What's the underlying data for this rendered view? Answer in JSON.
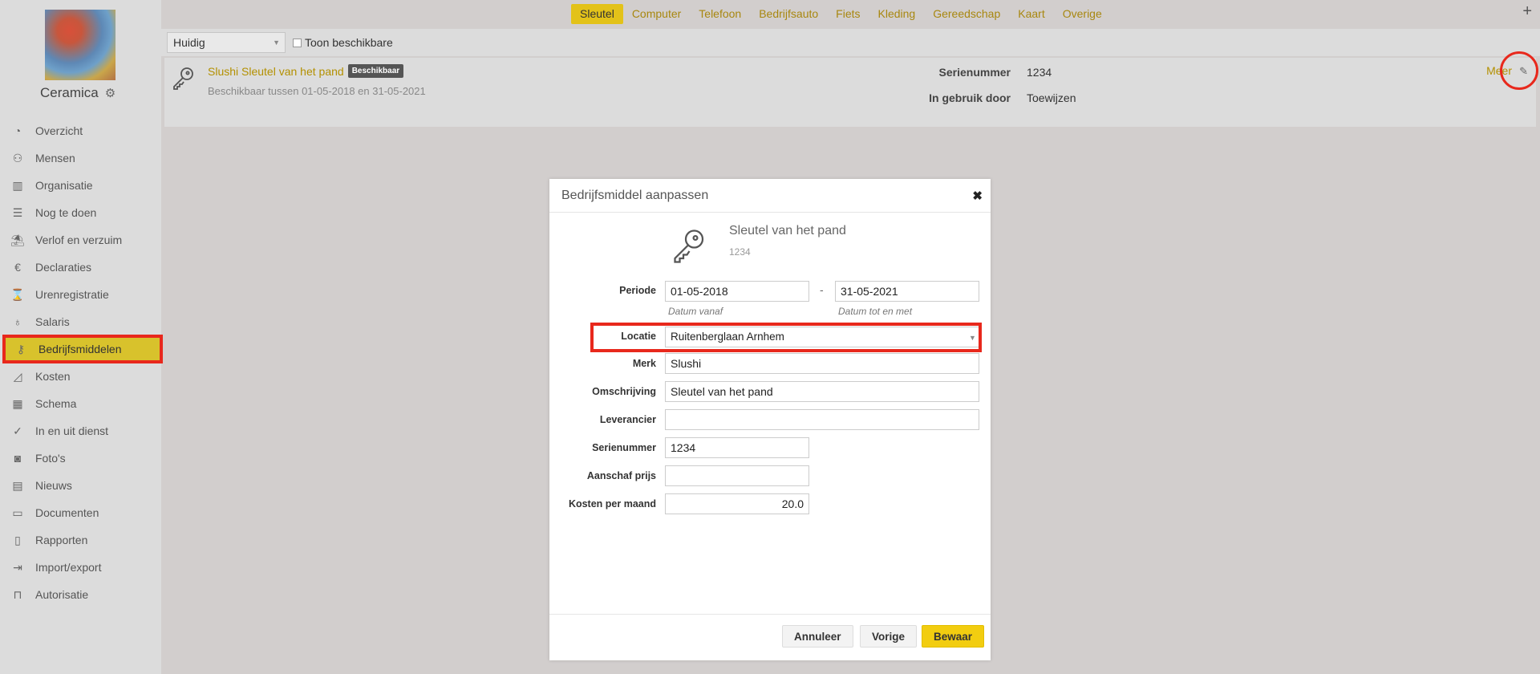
{
  "company": {
    "name": "Ceramica"
  },
  "sidebar": {
    "items": [
      {
        "label": "Overzicht",
        "icon": "pie-chart-icon"
      },
      {
        "label": "Mensen",
        "icon": "people-icon"
      },
      {
        "label": "Organisatie",
        "icon": "building-icon"
      },
      {
        "label": "Nog te doen",
        "icon": "checklist-icon"
      },
      {
        "label": "Verlof en verzuim",
        "icon": "beach-umbrella-icon"
      },
      {
        "label": "Declaraties",
        "icon": "euro-icon"
      },
      {
        "label": "Urenregistratie",
        "icon": "hourglass-icon"
      },
      {
        "label": "Salaris",
        "icon": "money-bag-icon"
      },
      {
        "label": "Bedrijfsmiddelen",
        "icon": "key-icon"
      },
      {
        "label": "Kosten",
        "icon": "area-chart-icon"
      },
      {
        "label": "Schema",
        "icon": "calendar-icon"
      },
      {
        "label": "In en uit dienst",
        "icon": "user-check-icon"
      },
      {
        "label": "Foto's",
        "icon": "camera-icon"
      },
      {
        "label": "Nieuws",
        "icon": "newspaper-icon"
      },
      {
        "label": "Documenten",
        "icon": "folder-icon"
      },
      {
        "label": "Rapporten",
        "icon": "report-icon"
      },
      {
        "label": "Import/export",
        "icon": "import-icon"
      },
      {
        "label": "Autorisatie",
        "icon": "lock-icon"
      }
    ],
    "active_index": 8
  },
  "tabs": [
    "Sleutel",
    "Computer",
    "Telefoon",
    "Bedrijfsauto",
    "Fiets",
    "Kleding",
    "Gereedschap",
    "Kaart",
    "Overige"
  ],
  "active_tab": "Sleutel",
  "filter": {
    "selected": "Huidig",
    "checkbox_label": "Toon beschikbare"
  },
  "asset": {
    "title": "Slushi Sleutel van het pand",
    "badge": "Beschikbaar",
    "subtitle": "Beschikbaar tussen 01-05-2018 en 31-05-2021",
    "serial_label": "Serienummer",
    "serial_value": "1234",
    "used_by_label": "In gebruik door",
    "used_by_value": "Toewijzen",
    "more_label": "Meer"
  },
  "modal": {
    "title": "Bedrijfsmiddel aanpassen",
    "item_name": "Sleutel van het pand",
    "item_number": "1234",
    "periode_label": "Periode",
    "date_from": "01-05-2018",
    "date_to": "31-05-2021",
    "dash": "-",
    "hint_from": "Datum vanaf",
    "hint_to": "Datum tot en met",
    "locatie_label": "Locatie",
    "locatie_value": "Ruitenberglaan Arnhem",
    "merk_label": "Merk",
    "merk_value": "Slushi",
    "omschrijving_label": "Omschrijving",
    "omschrijving_value": "Sleutel van het pand",
    "leverancier_label": "Leverancier",
    "leverancier_value": "",
    "serienummer_label": "Serienummer",
    "serienummer_value": "1234",
    "aanschaf_label": "Aanschaf prijs",
    "aanschaf_value": "",
    "kosten_label": "Kosten per maand",
    "kosten_value": "20.0",
    "btn_cancel": "Annuleer",
    "btn_prev": "Vorige",
    "btn_save": "Bewaar"
  },
  "colors": {
    "accent": "#e3c219",
    "link": "#b39000",
    "highlight": "#e8281c"
  }
}
